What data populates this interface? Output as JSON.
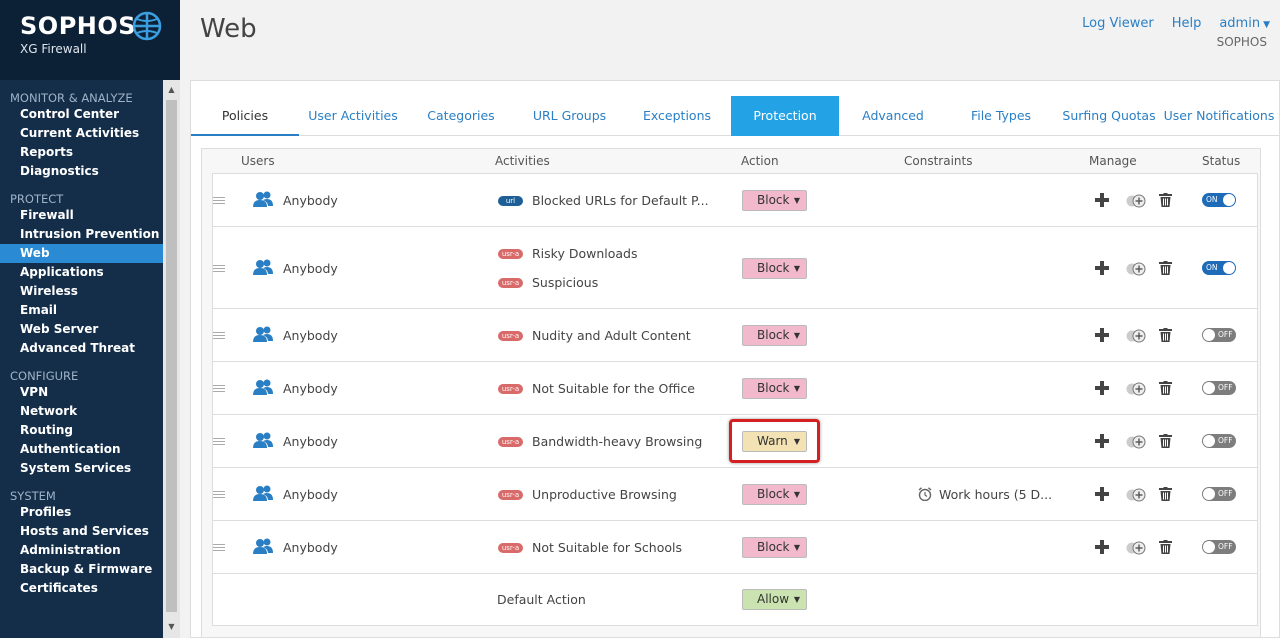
{
  "brand": {
    "logo": "SOPHOS",
    "product": "XG Firewall"
  },
  "sidebar": {
    "sections": [
      {
        "title": "MONITOR & ANALYZE",
        "items": [
          "Control Center",
          "Current Activities",
          "Reports",
          "Diagnostics"
        ]
      },
      {
        "title": "PROTECT",
        "items": [
          "Firewall",
          "Intrusion Prevention",
          "Web",
          "Applications",
          "Wireless",
          "Email",
          "Web Server",
          "Advanced Threat"
        ]
      },
      {
        "title": "CONFIGURE",
        "items": [
          "VPN",
          "Network",
          "Routing",
          "Authentication",
          "System Services"
        ]
      },
      {
        "title": "SYSTEM",
        "items": [
          "Profiles",
          "Hosts and Services",
          "Administration",
          "Backup & Firmware",
          "Certificates"
        ]
      }
    ],
    "active_item": "Web"
  },
  "header": {
    "title": "Web",
    "log_viewer": "Log Viewer",
    "help": "Help",
    "user": "admin",
    "company": "SOPHOS"
  },
  "tabs": [
    "Policies",
    "User Activities",
    "Categories",
    "URL Groups",
    "Exceptions",
    "Protection",
    "Advanced",
    "File Types",
    "Surfing Quotas",
    "User Notifications"
  ],
  "table": {
    "columns": [
      "Users",
      "Activities",
      "Action",
      "Constraints",
      "Manage",
      "Status"
    ],
    "rows": [
      {
        "user": "Anybody",
        "activities": [
          {
            "tag": "url",
            "label": "Blocked URLs for Default P..."
          }
        ],
        "action": "Block",
        "constraint": "",
        "status": "ON"
      },
      {
        "user": "Anybody",
        "activities": [
          {
            "tag": "usr-a",
            "label": "Risky Downloads"
          },
          {
            "tag": "usr-a",
            "label": "Suspicious"
          }
        ],
        "action": "Block",
        "constraint": "",
        "status": "ON"
      },
      {
        "user": "Anybody",
        "activities": [
          {
            "tag": "usr-a",
            "label": "Nudity and Adult Content"
          }
        ],
        "action": "Block",
        "constraint": "",
        "status": "OFF"
      },
      {
        "user": "Anybody",
        "activities": [
          {
            "tag": "usr-a",
            "label": "Not Suitable for the Office"
          }
        ],
        "action": "Block",
        "constraint": "",
        "status": "OFF"
      },
      {
        "user": "Anybody",
        "activities": [
          {
            "tag": "usr-a",
            "label": "Bandwidth-heavy Browsing"
          }
        ],
        "action": "Warn",
        "constraint": "",
        "status": "OFF"
      },
      {
        "user": "Anybody",
        "activities": [
          {
            "tag": "usr-a",
            "label": "Unproductive Browsing"
          }
        ],
        "action": "Block",
        "constraint": "Work hours (5 D...",
        "status": "OFF"
      },
      {
        "user": "Anybody",
        "activities": [
          {
            "tag": "usr-a",
            "label": "Not Suitable for Schools"
          }
        ],
        "action": "Block",
        "constraint": "",
        "status": "OFF"
      }
    ],
    "default_row": {
      "label": "Default Action",
      "action": "Allow"
    }
  },
  "colors": {
    "accent": "#2a7fc4",
    "sidebar_bg": "#142e4a",
    "active_tab": "#23a3e6",
    "block": "#f1b9cb",
    "warn": "#f3e2b3",
    "allow": "#cbe3b0",
    "highlight": "#d42020"
  }
}
